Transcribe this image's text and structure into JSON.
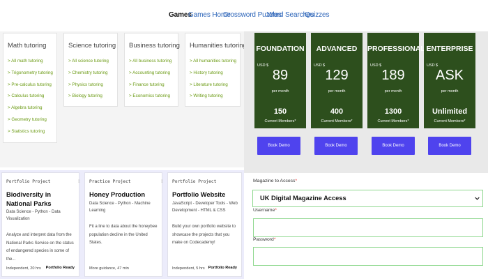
{
  "nav": {
    "items": [
      {
        "label": "Games"
      },
      {
        "label": "Games Home"
      },
      {
        "label": "Crossword Puzzles"
      },
      {
        "label": "Word Searches"
      },
      {
        "label": "Quizzes"
      }
    ]
  },
  "tutoring": {
    "cards": [
      {
        "title": "Math tutoring",
        "items": [
          "All math tutoring",
          "Trigonometry tutoring",
          "Pre-calculus tutoring",
          "Calculus tutoring",
          "Algebra tutoring",
          "Geometry tutoring",
          "Statistics tutoring"
        ]
      },
      {
        "title": "Science tutoring",
        "items": [
          "All science tutoring",
          "Chemistry tutoring",
          "Physics tutoring",
          "Biology tutoring"
        ]
      },
      {
        "title": "Business tutoring",
        "items": [
          "All business tutoring",
          "Accounting tutoring",
          "Finance tutoring",
          "Economics tutoring"
        ]
      },
      {
        "title": "Humanities tutoring",
        "items": [
          "All humanities tutoring",
          "History tutoring",
          "Literature tutoring",
          "Writing tutoring"
        ]
      }
    ]
  },
  "pricing": {
    "plans": [
      {
        "name": "FOUNDATION",
        "currency": "USD $",
        "amount": "89",
        "period": "per month",
        "members": "150",
        "members_label": "Current Members*",
        "button": "Book Demo"
      },
      {
        "name": "ADVANCED",
        "currency": "USD $",
        "amount": "129",
        "period": "per month",
        "members": "400",
        "members_label": "Current Members*",
        "button": "Book Demo"
      },
      {
        "name": "PROFESSIONAL",
        "currency": "USD $",
        "amount": "189",
        "period": "per month",
        "members": "1300",
        "members_label": "Current Members*",
        "button": "Book Demo"
      },
      {
        "name": "ENTERPRISE",
        "currency": "USD $",
        "amount": "ASK",
        "period": "per month",
        "members": "Unlimited",
        "members_label": "Current Members*",
        "button": "Book Demo"
      }
    ]
  },
  "projects": [
    {
      "type": "Portfolio Project",
      "title": "Biodiversity in National Parks",
      "tags": "Data Science - Python - Data Visualization",
      "description": "Analyze and interpret data from the National Parks Service on the status of endangered species in some of the...",
      "meta": "Independent, 20 hrs",
      "badge": "Portfolio Ready"
    },
    {
      "type": "Practice Project",
      "title": "Honey Production",
      "tags": "Data Science - Python - Machine Learning",
      "description": "Fit a line to data about the honeybee population decline in the United States.",
      "meta": "More guidance, 47 min",
      "badge": ""
    },
    {
      "type": "Portfolio Project",
      "title": "Portfolio Website",
      "tags": "JavaScript - Developer Tools - Web Development - HTML & CSS",
      "description": "Build your own portfolio website to showcase the projects that you make on Codecademy!",
      "meta": "Independent, 5 hrs",
      "badge": "Portfolio Ready"
    }
  ],
  "form": {
    "magazine_label": "Magazine to Access",
    "magazine_value": "UK Digital Magazine Access",
    "username_label": "Username",
    "username_value": "",
    "password_label": "Password",
    "password_value": "",
    "required_mark": "*"
  },
  "colors": {
    "plan_card": "#2d4f1d",
    "plan_button": "#4f43ee",
    "tutoring_link": "#6a9a12",
    "nav_link": "#2a63b8",
    "input_border": "#8fd88f",
    "projects_bg": "#ececfb"
  },
  "icons": {
    "select_arrow": "chevron-down-icon"
  }
}
